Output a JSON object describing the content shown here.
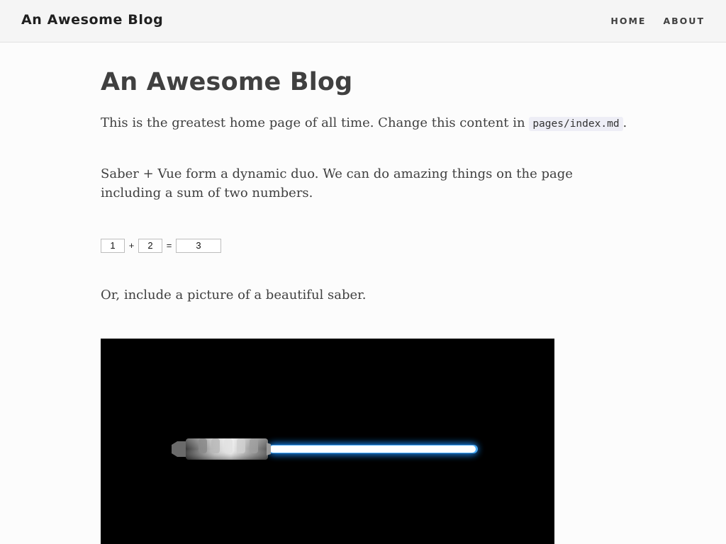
{
  "navbar": {
    "brand": "An Awesome Blog",
    "links": [
      {
        "label": "HOME"
      },
      {
        "label": "ABOUT"
      }
    ]
  },
  "page": {
    "title": "An Awesome Blog",
    "intro_text": "This is the greatest home page of all time. Change this content in ",
    "intro_code": "pages/index.md",
    "intro_end": ".",
    "duo_text": "Saber + Vue form a dynamic duo. We can do amazing things on the page including a sum of two numbers.",
    "sum": {
      "a": "1",
      "plus": "+",
      "b": "2",
      "equals": "=",
      "result": "3"
    },
    "picture_text": "Or, include a picture of a beautiful saber."
  },
  "image": {
    "background": "#000000",
    "blade_color": "#1e90ff",
    "blade_core_color": "#ffffff"
  }
}
